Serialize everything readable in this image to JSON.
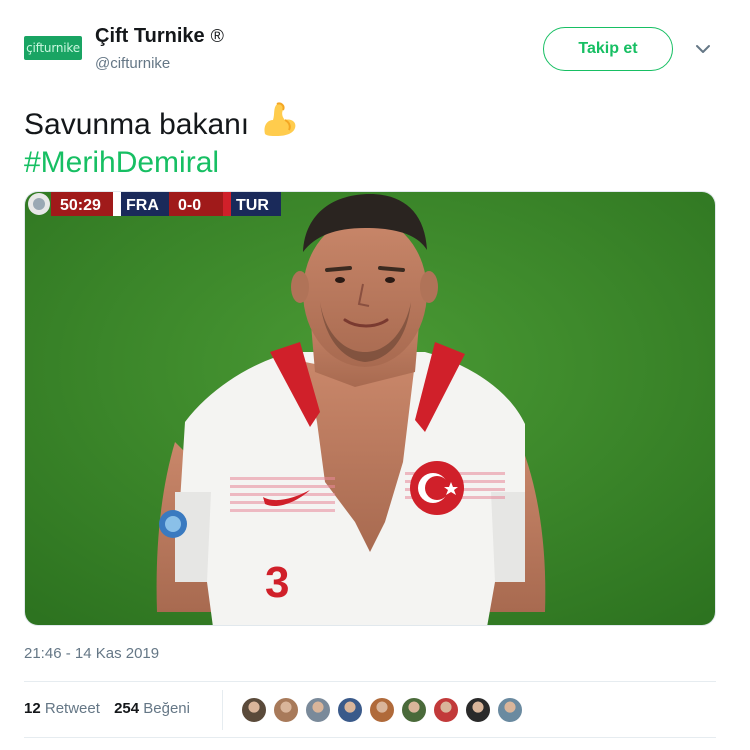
{
  "author": {
    "display_name": "Çift Turnike",
    "registered_mark": "®",
    "handle": "@cifturnike",
    "avatar_text": "çifturnike"
  },
  "follow_button": {
    "label": "Takip et"
  },
  "more_menu": {
    "icon": "chevron-down-icon"
  },
  "tweet": {
    "text_line1": "Savunma bakanı",
    "emoji": "flexed-biceps",
    "hashtag": "#MerihDemiral"
  },
  "media": {
    "scoreboard": {
      "time": "50:29",
      "home": "FRA",
      "score": "0-0",
      "away": "TUR"
    },
    "shirt_number": "3"
  },
  "timestamp": "21:46 - 14 Kas 2019",
  "stats": {
    "retweet_count": "12",
    "retweet_label": "Retweet",
    "like_count": "254",
    "like_label": "Beğeni"
  },
  "likers": [
    {
      "color": "#5a4a3a"
    },
    {
      "color": "#a87a5a"
    },
    {
      "color": "#7a8a9a"
    },
    {
      "color": "#3a5a8a"
    },
    {
      "color": "#b06a3a"
    },
    {
      "color": "#4a6a3a"
    },
    {
      "color": "#c23a3a"
    },
    {
      "color": "#2a2a2a"
    },
    {
      "color": "#6a8aa0"
    }
  ],
  "colors": {
    "accent": "#17bf63",
    "pitch": "#3d8a2a",
    "jersey_red": "#d0202a"
  }
}
